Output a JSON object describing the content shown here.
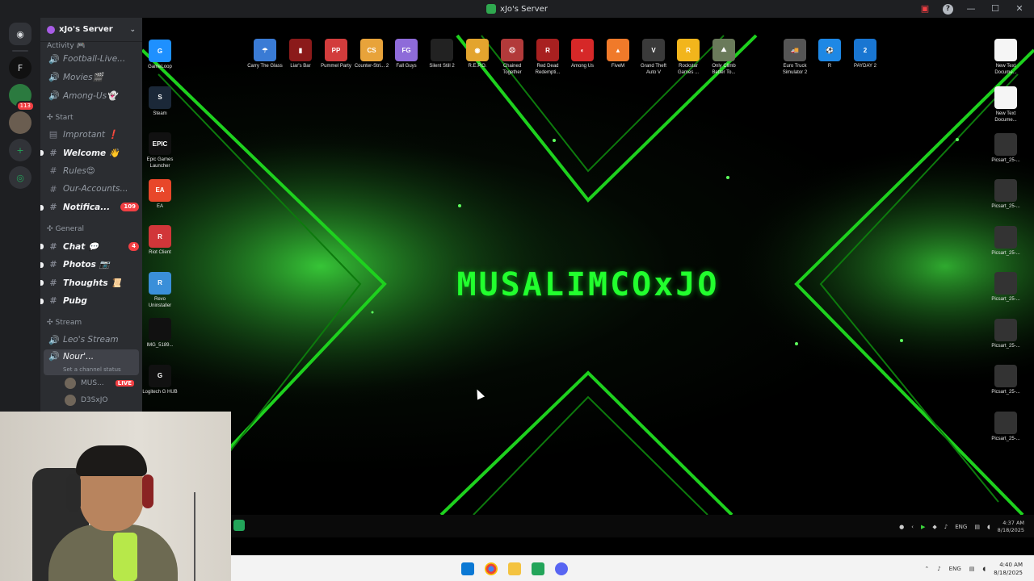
{
  "window": {
    "title": "xJo's Server"
  },
  "server": {
    "name": "xJo's Server"
  },
  "rail": {
    "dm_badge": "",
    "server_badge": "113"
  },
  "channels": {
    "top_partial": "Activity 🎮",
    "items": [
      {
        "icon": "speaker",
        "name": "Football-Live..."
      },
      {
        "icon": "speaker",
        "name": "Movies🎬"
      },
      {
        "icon": "speaker",
        "name": "Among-Us👻"
      }
    ],
    "category_start": "Start",
    "start_items": [
      {
        "icon": "rules",
        "name": "Improtant ❗",
        "unread": false
      },
      {
        "icon": "hash",
        "name": "Welcome 👋",
        "unread": true
      },
      {
        "icon": "hash",
        "name": "Rules😍",
        "unread": false
      },
      {
        "icon": "hash",
        "name": "Our-Accounts...",
        "unread": false
      },
      {
        "icon": "hash",
        "name": "Notifica...",
        "unread": true,
        "count": "109"
      }
    ],
    "category_general": "General",
    "general_items": [
      {
        "icon": "hash",
        "name": "Chat 💬",
        "unread": true,
        "count": "4"
      },
      {
        "icon": "hash",
        "name": "Photos 📷",
        "unread": true
      },
      {
        "icon": "hash",
        "name": "Thoughts 📜",
        "unread": true
      },
      {
        "icon": "hash",
        "name": "Pubg",
        "unread": true
      }
    ],
    "category_stream": "Stream",
    "stream_items": [
      {
        "icon": "speaker",
        "name": "Leo's Stream"
      }
    ],
    "active": {
      "name": "Nour'...",
      "status": "Set a channel status"
    },
    "voice_users": [
      {
        "name": "MUS...",
        "live": "LIVE"
      },
      {
        "name": "D3SxJO",
        "live": ""
      }
    ]
  },
  "desktop": {
    "wallpaper_text": "MUSALIMCOxJO",
    "top_icons": [
      {
        "label": "Carry The Glass",
        "color": "#3a7bd5",
        "glyph": "☂"
      },
      {
        "label": "Liar's Bar",
        "color": "#8b1a1a",
        "glyph": "▮"
      },
      {
        "label": "Pummel Party",
        "color": "#d23c3c",
        "glyph": "PP"
      },
      {
        "label": "Counter-Stri... 2",
        "color": "#e8a33a",
        "glyph": "CS"
      },
      {
        "label": "Fall Guys",
        "color": "#8e6bd9",
        "glyph": "FG"
      },
      {
        "label": "Silent Still 2",
        "color": "#222222",
        "glyph": ""
      },
      {
        "label": "R.E.P.O.",
        "color": "#e3a42e",
        "glyph": "◉"
      },
      {
        "label": "Chained Together",
        "color": "#b23a3a",
        "glyph": "☹"
      },
      {
        "label": "Red Dead Redempti...",
        "color": "#a82020",
        "glyph": "R"
      },
      {
        "label": "Among Us",
        "color": "#d62828",
        "glyph": "◐"
      },
      {
        "label": "FiveM",
        "color": "#f07a2a",
        "glyph": "▲"
      },
      {
        "label": "Grand Theft Auto V",
        "color": "#3a3a3a",
        "glyph": "V"
      },
      {
        "label": "Rockstar Games ...",
        "color": "#f2b51c",
        "glyph": "R"
      },
      {
        "label": "Only Climb Better To...",
        "color": "#6a7a5a",
        "glyph": "⛰"
      },
      {
        "label": "Euro Truck Simulator 2",
        "color": "#555555",
        "glyph": "🚚"
      },
      {
        "label": "R",
        "color": "#1e88e5",
        "glyph": "⚽"
      },
      {
        "label": "PAYDAY 2",
        "color": "#1976d2",
        "glyph": "2"
      },
      {
        "label": "New Text Docume...",
        "color": "#f5f5f5",
        "glyph": ""
      }
    ],
    "left_icons": [
      {
        "label": "GameLoop",
        "color": "#1e90ff",
        "glyph": "G"
      },
      {
        "label": "Steam",
        "color": "#1b2838",
        "glyph": "S"
      },
      {
        "label": "Epic Games Launcher",
        "color": "#111111",
        "glyph": "EPIC"
      },
      {
        "label": "EA",
        "color": "#e8472a",
        "glyph": "EA"
      },
      {
        "label": "Riot Client",
        "color": "#d13639",
        "glyph": "R"
      },
      {
        "label": "Revo Uninstaller",
        "color": "#3a8fd9",
        "glyph": "R"
      },
      {
        "label": "IMG_5189...",
        "color": "#111111",
        "glyph": ""
      },
      {
        "label": "Logitech G HUB",
        "color": "#111111",
        "glyph": "G"
      }
    ],
    "right_icons": [
      {
        "label": "New Text Docume...",
        "color": "#f5f5f5"
      },
      {
        "label": "Picsart_25-...",
        "color": "#333333"
      },
      {
        "label": "Picsart_25-...",
        "color": "#333333"
      },
      {
        "label": "Picsart_25-...",
        "color": "#333333"
      },
      {
        "label": "Picsart_25-...",
        "color": "#333333"
      },
      {
        "label": "Picsart_25-...",
        "color": "#333333"
      },
      {
        "label": "Picsart_25-...",
        "color": "#333333"
      },
      {
        "label": "Picsart_25-...",
        "color": "#333333"
      }
    ],
    "inner_tray": {
      "lang": "ENG",
      "time": "4:37 AM",
      "date": "8/18/2025"
    }
  },
  "taskbar": {
    "lang": "ENG",
    "time": "4:40 AM",
    "date": "8/18/2025"
  },
  "colors": {
    "accent_green": "#22ff2e",
    "discord_bg": "#2b2d31",
    "badge_red": "#f23f43"
  }
}
